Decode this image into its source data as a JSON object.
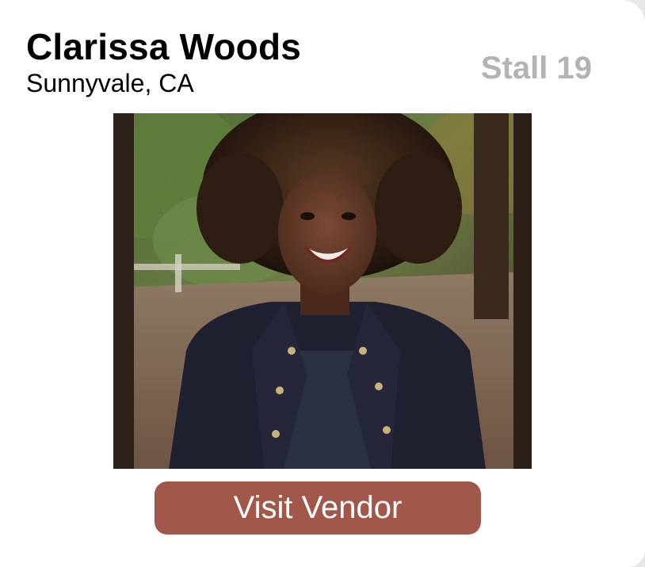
{
  "vendor": {
    "name": "Clarissa Woods",
    "location": "Sunnyvale, CA",
    "stall": "Stall 19"
  },
  "actions": {
    "visit_label": "Visit Vendor"
  },
  "colors": {
    "button": "#a15749",
    "stall_text": "#b3b3b3"
  }
}
